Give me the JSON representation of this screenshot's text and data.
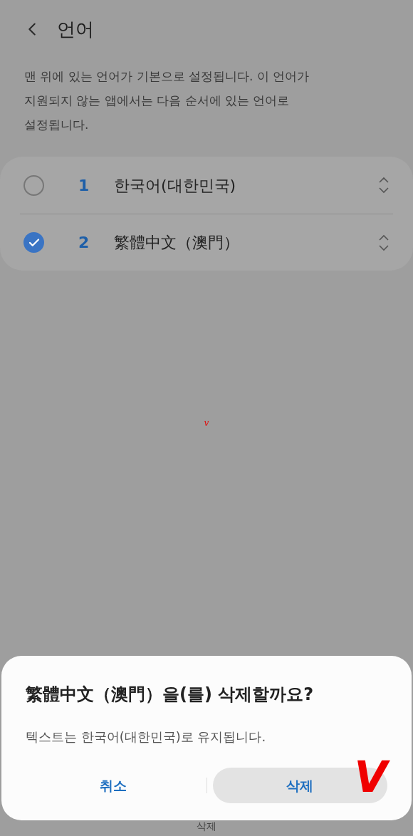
{
  "header": {
    "title": "언어"
  },
  "description": "맨 위에 있는 언어가 기본으로 설정됩니다. 이 언어가 지원되지 않는 앱에서는 다음 순서에 있는 언어로 설정됩니다.",
  "languages": [
    {
      "number": "1",
      "name": "한국어(대한민국)",
      "checked": false
    },
    {
      "number": "2",
      "name": "繁體中文（澳門）",
      "checked": true
    }
  ],
  "annotations": [
    {
      "text": "v",
      "kind": "small"
    },
    {
      "text": "V",
      "kind": "large"
    }
  ],
  "bottom_bar": {
    "label": "삭제"
  },
  "dialog": {
    "title": "繁體中文（澳門）을(를) 삭제할까요?",
    "message": "텍스트는 한국어(대한민국)로 유지됩니다.",
    "buttons": [
      {
        "label": "취소",
        "selected": false
      },
      {
        "label": "삭제",
        "selected": true
      }
    ]
  }
}
